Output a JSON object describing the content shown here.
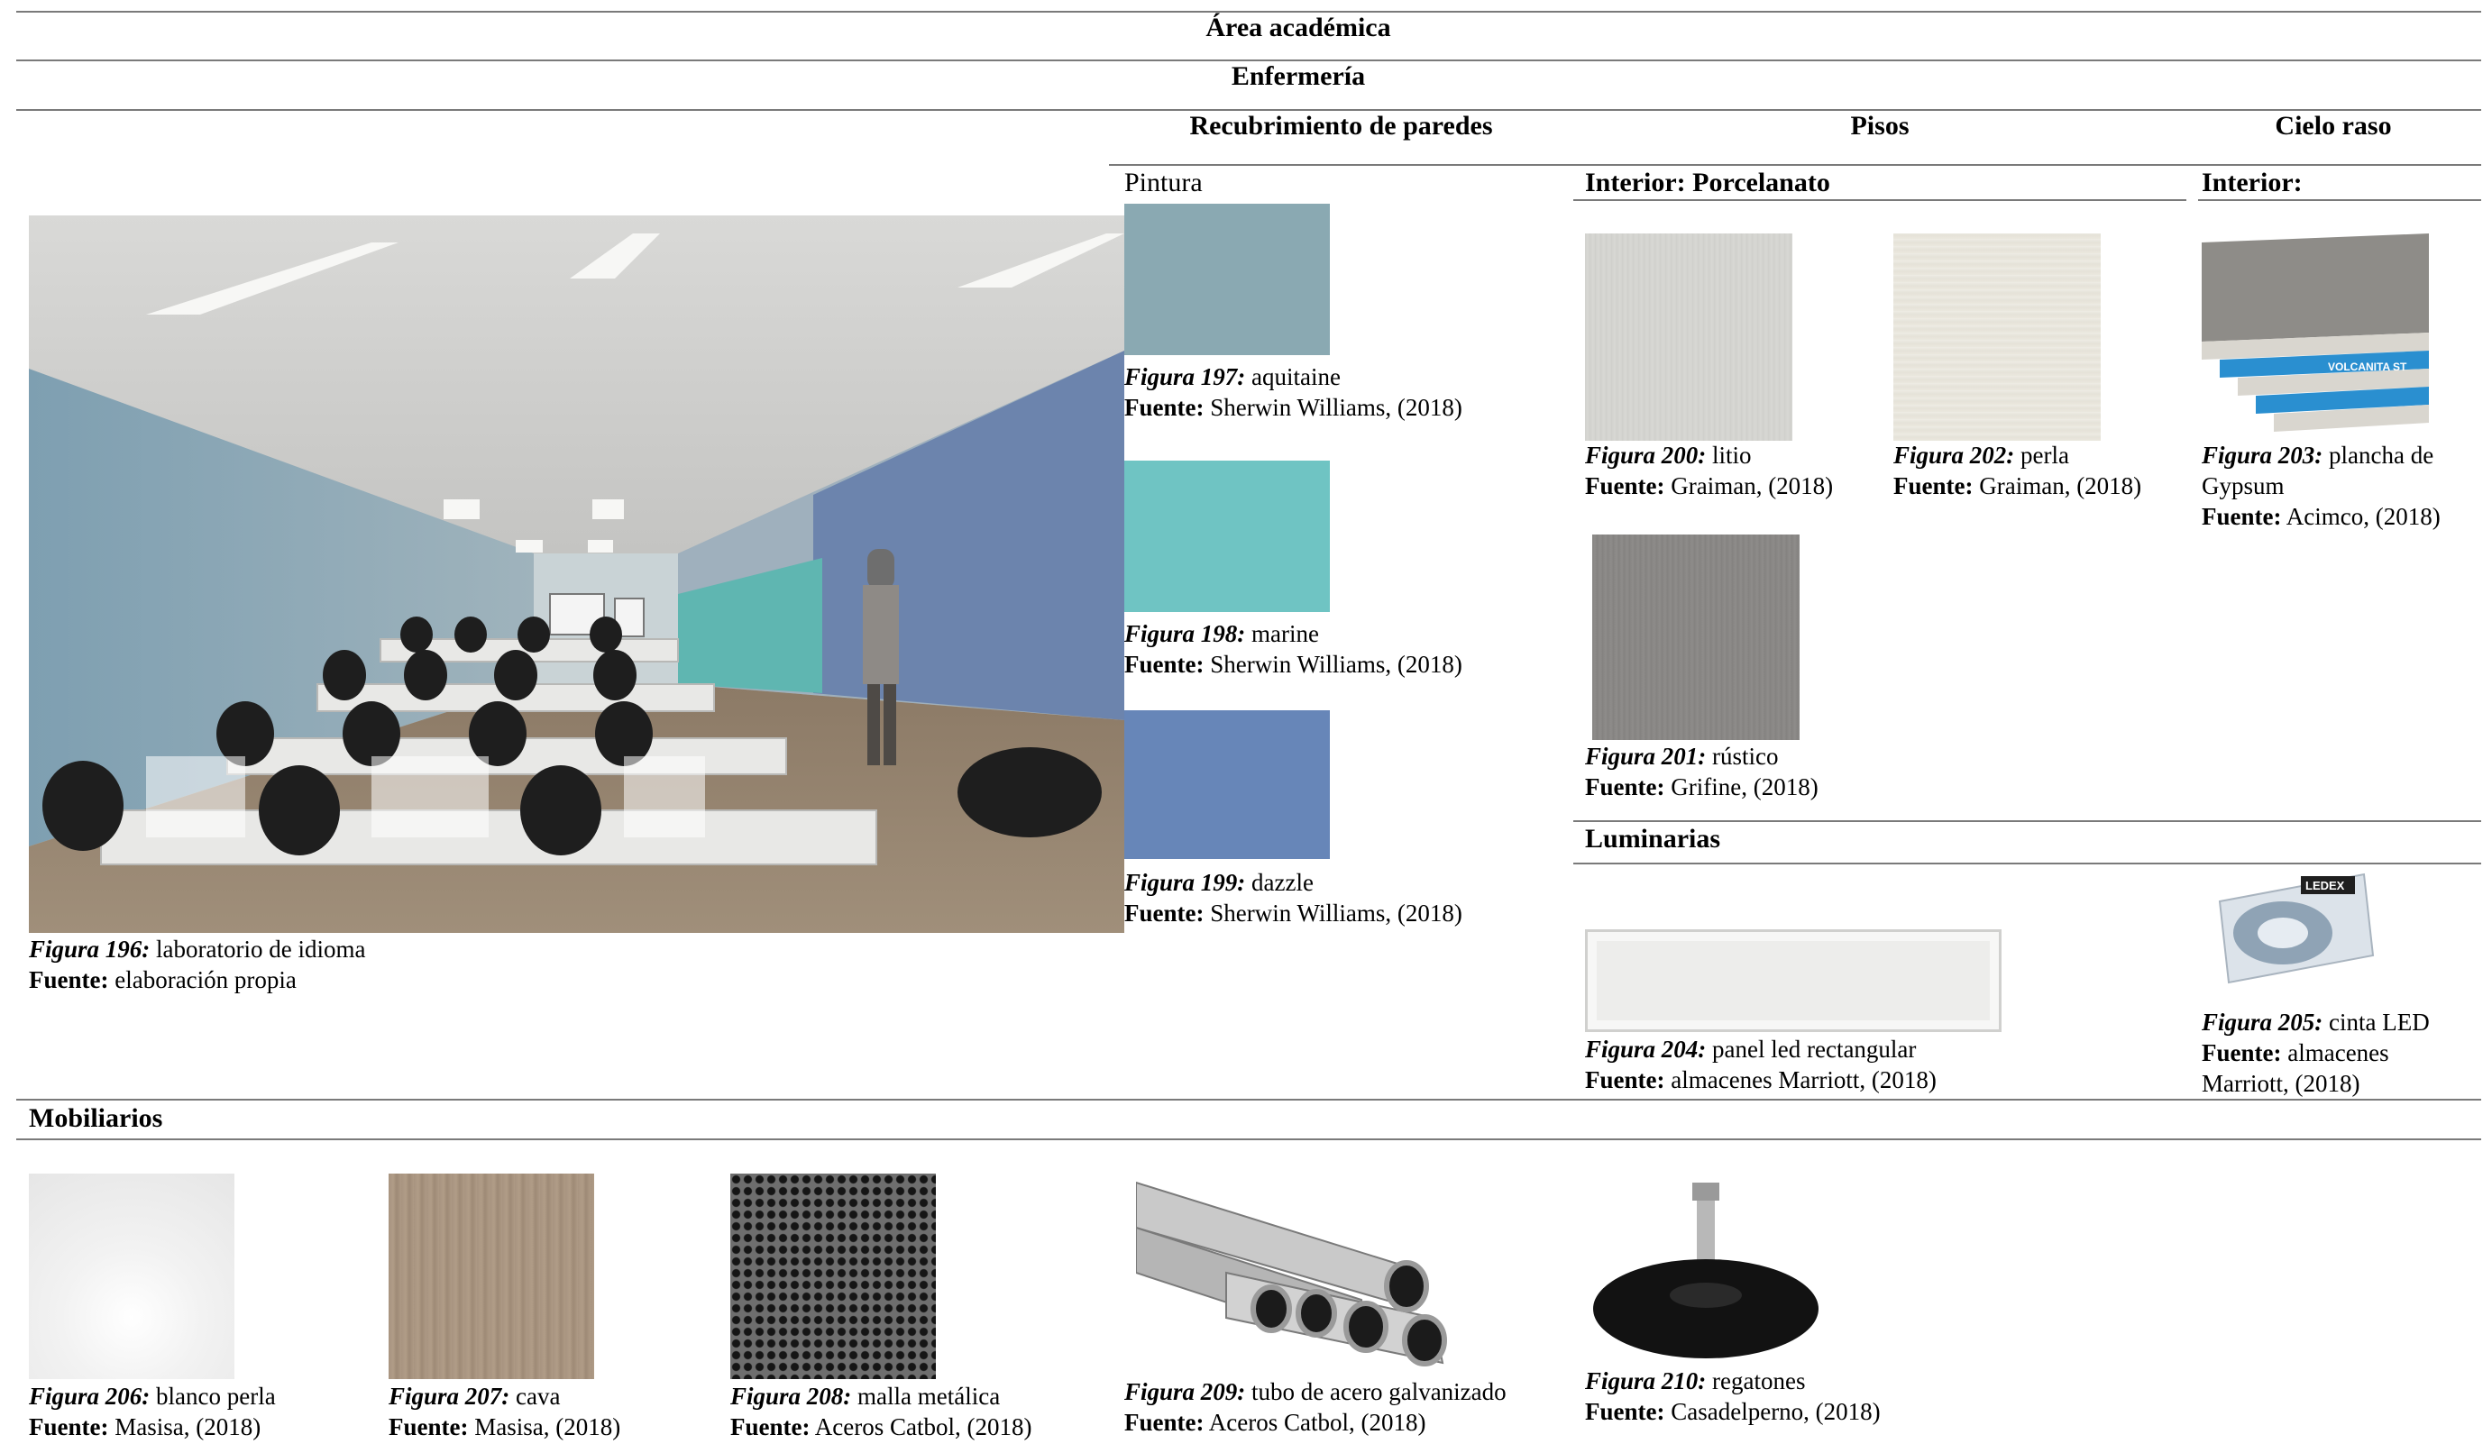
{
  "title": "Área académica",
  "subtitle": "Enfermería",
  "columns": {
    "walls": "Recubrimiento de paredes",
    "floors": "Pisos",
    "ceiling": "Cielo raso"
  },
  "walls": {
    "label": "Pintura",
    "items": [
      {
        "fig": "Figura 197:",
        "name": " aquitaine",
        "src_label": "Fuente:",
        "src": " Sherwin Williams, (2018)",
        "color": "#8aa9b2"
      },
      {
        "fig": "Figura 198:",
        "name": " marine",
        "src_label": "Fuente:",
        "src": " Sherwin Williams, (2018)",
        "color": "#6fc4c3"
      },
      {
        "fig": "Figura 199:",
        "name": " dazzle",
        "src_label": "Fuente:",
        "src": " Sherwin Williams, (2018)",
        "color": "#6786b8"
      }
    ]
  },
  "render": {
    "fig": "Figura 196:",
    "name": " laboratorio de idioma",
    "src_label": "Fuente:",
    "src": " elaboración propia"
  },
  "floors": {
    "label": "Interior: Porcelanato",
    "items": [
      {
        "fig": "Figura 200:",
        "name": " litio",
        "src_label": "Fuente:",
        "src": " Graiman, (2018)",
        "color": "#d4d4d0"
      },
      {
        "fig": "Figura 202:",
        "name": " perla",
        "src_label": "Fuente:",
        "src": " Graiman, (2018)",
        "color": "#e9e6dd"
      },
      {
        "fig": "Figura 201:",
        "name": " rústico",
        "src_label": "Fuente:",
        "src": " Grifine, (2018)",
        "color": "#8a8886"
      }
    ]
  },
  "ceiling": {
    "label": "Interior:",
    "item": {
      "fig": "Figura 203:",
      "name": " plancha de Gypsum",
      "src_label": "Fuente:",
      "src": " Acimco, (2018)",
      "brand": "VOLCANITA ST"
    }
  },
  "lighting": {
    "label": "Luminarias",
    "items": [
      {
        "fig": "Figura 204:",
        "name": " panel led rectangular",
        "src_label": "Fuente:",
        "src": " almacenes Marriott, (2018)"
      },
      {
        "fig": "Figura 205:",
        "name": " cinta LED",
        "src_label": "Fuente:",
        "src": " almacenes Marriott, (2018)",
        "brand": "LEDEX"
      }
    ]
  },
  "furniture": {
    "label": "Mobiliarios",
    "items": [
      {
        "fig": "Figura 206:",
        "name": " blanco perla",
        "src_label": "Fuente:",
        "src": " Masisa, (2018)"
      },
      {
        "fig": "Figura 207:",
        "name": " cava",
        "src_label": "Fuente:",
        "src": " Masisa, (2018)"
      },
      {
        "fig": "Figura 208:",
        "name": " malla metálica",
        "src_label": "Fuente:",
        "src": " Aceros Catbol, (2018)"
      },
      {
        "fig": "Figura 209:",
        "name": " tubo de acero galvanizado",
        "src_label": "Fuente:",
        "src": " Aceros Catbol, (2018)"
      },
      {
        "fig": "Figura 210:",
        "name": " regatones",
        "src_label": "Fuente:",
        "src": " Casadelperno, (2018)"
      }
    ]
  }
}
